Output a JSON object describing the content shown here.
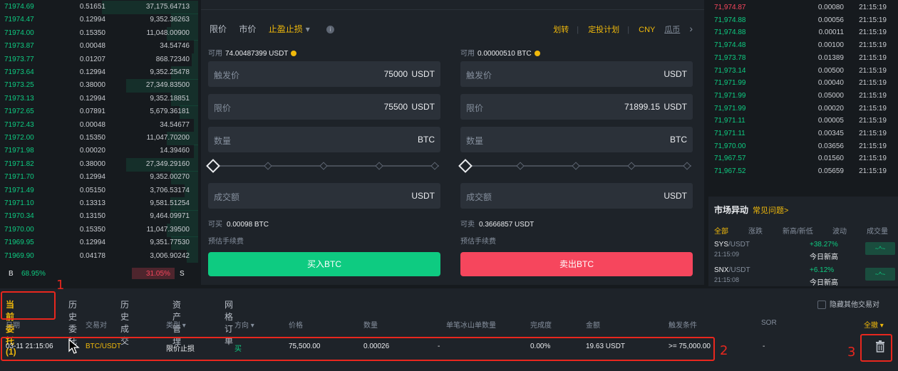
{
  "left_book": {
    "rows": [
      {
        "price": "71974.69",
        "amount": "0.51651",
        "total": "37,175.64713"
      },
      {
        "price": "71974.47",
        "amount": "0.12994",
        "total": "9,352.36263"
      },
      {
        "price": "71974.00",
        "amount": "0.15350",
        "total": "11,048.00900"
      },
      {
        "price": "71973.87",
        "amount": "0.00048",
        "total": "34.54746"
      },
      {
        "price": "71973.77",
        "amount": "0.01207",
        "total": "868.72340"
      },
      {
        "price": "71973.64",
        "amount": "0.12994",
        "total": "9,352.25478"
      },
      {
        "price": "71973.25",
        "amount": "0.38000",
        "total": "27,349.83500"
      },
      {
        "price": "71973.13",
        "amount": "0.12994",
        "total": "9,352.18851"
      },
      {
        "price": "71972.65",
        "amount": "0.07891",
        "total": "5,679.36181"
      },
      {
        "price": "71972.43",
        "amount": "0.00048",
        "total": "34.54677"
      },
      {
        "price": "71972.00",
        "amount": "0.15350",
        "total": "11,047.70200"
      },
      {
        "price": "71971.98",
        "amount": "0.00020",
        "total": "14.39460"
      },
      {
        "price": "71971.82",
        "amount": "0.38000",
        "total": "27,349.29160"
      },
      {
        "price": "71971.70",
        "amount": "0.12994",
        "total": "9,352.00270"
      },
      {
        "price": "71971.49",
        "amount": "0.05150",
        "total": "3,706.53174"
      },
      {
        "price": "71971.10",
        "amount": "0.13313",
        "total": "9,581.51254"
      },
      {
        "price": "71970.34",
        "amount": "0.13150",
        "total": "9,464.09971"
      },
      {
        "price": "71970.00",
        "amount": "0.15350",
        "total": "11,047.39500"
      },
      {
        "price": "71969.95",
        "amount": "0.12994",
        "total": "9,351.77530"
      },
      {
        "price": "71969.90",
        "amount": "0.04178",
        "total": "3,006.90242"
      }
    ],
    "buy_letter": "B",
    "buy_pct": "68.95%",
    "sell_pct": "31.05%",
    "sell_letter": "S"
  },
  "trade": {
    "order_types": [
      "限价",
      "市价",
      "止盈止损"
    ],
    "order_type_arrow": "▾",
    "info_glyph": "i",
    "right_links": [
      "划转",
      "定投计划"
    ],
    "currency": "CNY",
    "currency_label": "瓜币",
    "chevron": "›",
    "buy": {
      "avail_label": "可用",
      "avail_value": "74.00487399 USDT",
      "trigger_label": "触发价",
      "trigger_value": "75000",
      "trigger_unit": "USDT",
      "limit_label": "限价",
      "limit_value": "75500",
      "limit_unit": "USDT",
      "qty_label": "数量",
      "qty_value": "",
      "qty_unit": "BTC",
      "turnover_label": "成交额",
      "turnover_unit": "USDT",
      "can_label": "可买",
      "can_value": "0.00098 BTC",
      "fee_label": "预估手续费",
      "button": "买入BTC"
    },
    "sell": {
      "avail_label": "可用",
      "avail_value": "0.00000510 BTC",
      "trigger_label": "触发价",
      "trigger_value": "",
      "trigger_unit": "USDT",
      "limit_label": "限价",
      "limit_value": "71899.15",
      "limit_unit": "USDT",
      "qty_label": "数量",
      "qty_value": "",
      "qty_unit": "BTC",
      "turnover_label": "成交额",
      "turnover_unit": "USDT",
      "can_label": "可卖",
      "can_value": "0.3666857 USDT",
      "fee_label": "预估手续费",
      "button": "卖出BTC"
    }
  },
  "right_book": {
    "rows": [
      {
        "price": "71,974.87",
        "amount": "0.00080",
        "time": "21:15:19",
        "side": "sell"
      },
      {
        "price": "71,974.88",
        "amount": "0.00056",
        "time": "21:15:19",
        "side": "buy"
      },
      {
        "price": "71,974.88",
        "amount": "0.00011",
        "time": "21:15:19",
        "side": "buy"
      },
      {
        "price": "71,974.48",
        "amount": "0.00100",
        "time": "21:15:19",
        "side": "buy"
      },
      {
        "price": "71,973.78",
        "amount": "0.01389",
        "time": "21:15:19",
        "side": "buy"
      },
      {
        "price": "71,973.14",
        "amount": "0.00500",
        "time": "21:15:19",
        "side": "buy"
      },
      {
        "price": "71,971.99",
        "amount": "0.00040",
        "time": "21:15:19",
        "side": "buy"
      },
      {
        "price": "71,971.99",
        "amount": "0.05000",
        "time": "21:15:19",
        "side": "buy"
      },
      {
        "price": "71,971.99",
        "amount": "0.00020",
        "time": "21:15:19",
        "side": "buy"
      },
      {
        "price": "71,971.11",
        "amount": "0.00005",
        "time": "21:15:19",
        "side": "buy"
      },
      {
        "price": "71,971.11",
        "amount": "0.00345",
        "time": "21:15:19",
        "side": "buy"
      },
      {
        "price": "71,970.00",
        "amount": "0.03656",
        "time": "21:15:19",
        "side": "buy"
      },
      {
        "price": "71,967.57",
        "amount": "0.01560",
        "time": "21:15:19",
        "side": "buy"
      },
      {
        "price": "71,967.52",
        "amount": "0.05659",
        "time": "21:15:19",
        "side": "buy"
      }
    ]
  },
  "market_movers": {
    "title": "市场异动",
    "faq": "常见问题>",
    "tabs": [
      "全部",
      "涨跌",
      "新高/新低",
      "波动",
      "成交量"
    ],
    "items": [
      {
        "pair_base": "SYS",
        "pair_quote": "/USDT",
        "time": "21:15:09",
        "pct": "+38.27%",
        "label": "今日新高",
        "badge": "~^~"
      },
      {
        "pair_base": "SNX",
        "pair_quote": "/USDT",
        "time": "21:15:08",
        "pct": "+6.12%",
        "label": "今日新高",
        "badge": "~^~"
      }
    ]
  },
  "orders": {
    "tabs": [
      "当前委托(1)",
      "历史委托",
      "历史成交",
      "资产管理",
      "网格订单"
    ],
    "hide_others": "隐藏其他交易对",
    "headers": [
      "日期",
      "交易对",
      "类型",
      "方向",
      "价格",
      "数量",
      "单笔冰山单数量",
      "完成度",
      "金额",
      "触发条件",
      "SOR",
      "全撤"
    ],
    "header_arrow": "▾",
    "row": {
      "date": "03-11 21:15:06",
      "pair": "BTC/USDT",
      "type": "限价止损",
      "side": "买",
      "price": "75,500.00",
      "qty": "0.00026",
      "iceberg": "-",
      "filled": "0.00%",
      "amount": "19.63 USDT",
      "trigger": ">= 75,000.00",
      "sor": "-"
    }
  },
  "annotations": [
    "1",
    "2",
    "3"
  ],
  "colors": {
    "bg": "#161a1e",
    "panel": "#1e2329",
    "green": "#0ecb81",
    "red": "#f6465d",
    "gold": "#f0b90b",
    "annotation": "#e8271e"
  }
}
